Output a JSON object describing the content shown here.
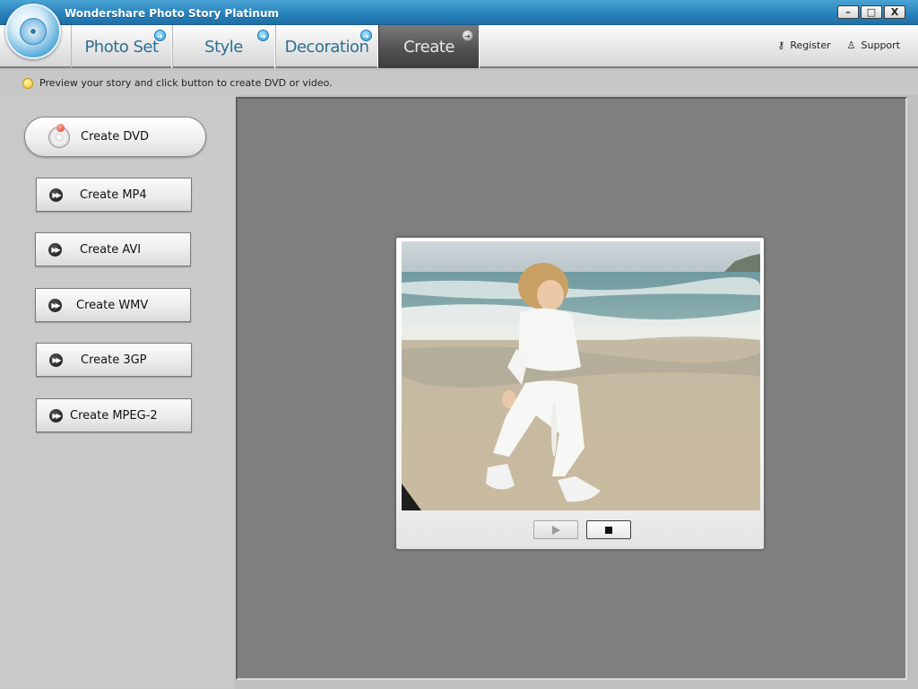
{
  "window": {
    "title": "Wondershare Photo Story Platinum",
    "controls": [
      "–",
      "□",
      "X"
    ]
  },
  "nav": {
    "tabs": [
      {
        "label": "Photo Set",
        "active": false
      },
      {
        "label": "Style",
        "active": false
      },
      {
        "label": "Decoration",
        "active": false
      },
      {
        "label": "Create",
        "active": true
      }
    ],
    "register_label": "Register",
    "support_label": "Support"
  },
  "hint": {
    "text": "Preview your story and click button to create DVD or video."
  },
  "create": {
    "dvd_label": "Create DVD",
    "formats": [
      {
        "label": "Create MP4"
      },
      {
        "label": "Create AVI"
      },
      {
        "label": "Create WMV"
      },
      {
        "label": "Create 3GP"
      },
      {
        "label": "Create MPEG-2"
      }
    ]
  },
  "preview": {
    "photo_icon": "child-on-beach-photo",
    "play_icon": "play-icon",
    "stop_icon": "stop-icon"
  },
  "colors": {
    "titlebar": "#2a83bd",
    "tab_text": "#2d6f93",
    "active_tab": "#4f4f4f",
    "preview_bg": "#7f7f7f"
  }
}
